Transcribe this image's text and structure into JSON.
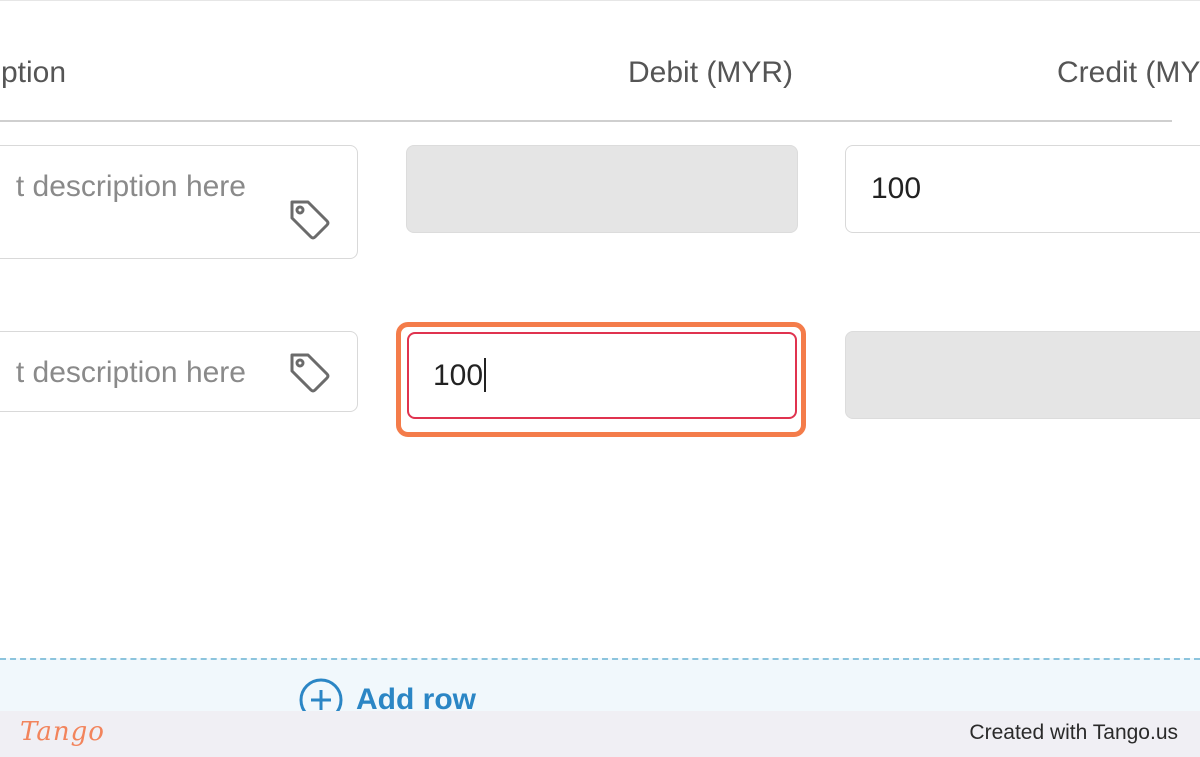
{
  "table": {
    "headers": {
      "description": "iption",
      "debit": "Debit (MYR)",
      "credit": "Credit (MY"
    },
    "rows": [
      {
        "description_placeholder": "t description here",
        "debit": "",
        "credit": "100"
      },
      {
        "description_placeholder": "t description here",
        "debit": "100",
        "credit": ""
      }
    ]
  },
  "actions": {
    "add_row_label": "Add row"
  },
  "footer": {
    "logo": "Tango",
    "created_with": "Created with Tango.us"
  },
  "colors": {
    "focus_highlight": "#f47c4a",
    "active_field_border": "#e0334f",
    "link_blue": "#2b86c5",
    "disabled_field": "#e5e5e5"
  }
}
